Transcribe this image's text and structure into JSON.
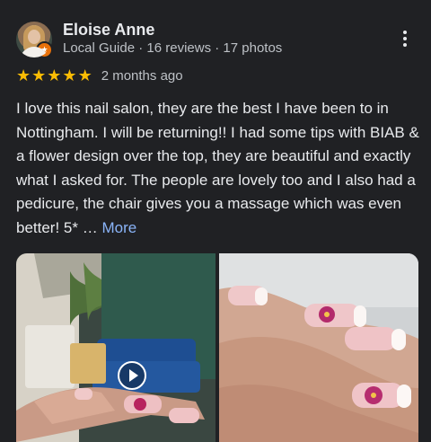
{
  "reviewer": {
    "name": "Eloise Anne",
    "meta": "Local Guide · 16 reviews · 17 photos",
    "avatar_icon": "profile-photo",
    "badge_icon": "local-guide-star-icon"
  },
  "rating": {
    "stars": 5,
    "star_color": "#fbbc04",
    "when": "2 months ago"
  },
  "review": {
    "text": "I love this nail salon, they are the best I have been to in Nottingham. I will be returning!! I had some tips with BIAB & a flower design over the top, they are beautiful and exactly what I asked for. The people are lovely too and I also had a pedicure, the chair gives you a massage which was even better! 5* …",
    "more_label": "More",
    "more_color": "#8ab4f8"
  },
  "photos": [
    {
      "kind": "video",
      "play_icon": "play-icon"
    },
    {
      "kind": "image"
    }
  ]
}
